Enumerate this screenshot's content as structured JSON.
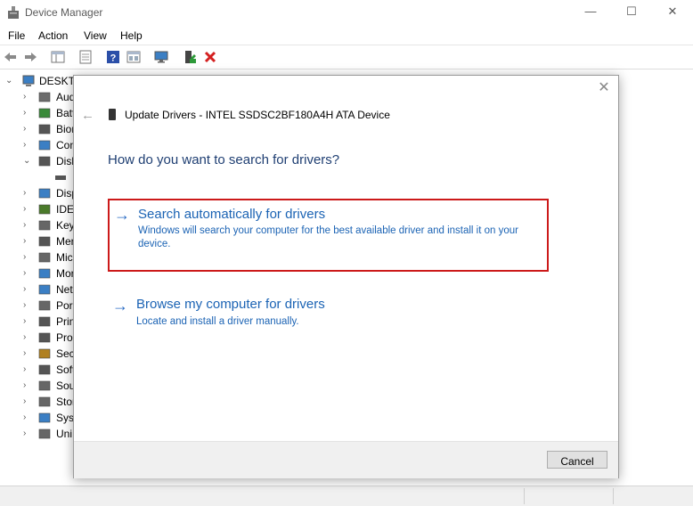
{
  "window": {
    "title": "Device Manager"
  },
  "menu": [
    "File",
    "Action",
    "View",
    "Help"
  ],
  "tree": {
    "root": "DESKTO",
    "items": [
      {
        "label": "Aud",
        "icon": "audio-icon"
      },
      {
        "label": "Batt",
        "icon": "battery-icon"
      },
      {
        "label": "Bior",
        "icon": "biometric-icon"
      },
      {
        "label": "Con",
        "icon": "computer-icon"
      },
      {
        "label": "Disk",
        "icon": "disk-drive-icon",
        "expanded": true
      },
      {
        "label": "",
        "icon": "drive-icon",
        "child": true
      },
      {
        "label": "Disp",
        "icon": "display-icon"
      },
      {
        "label": "IDE",
        "icon": "ide-controller-icon"
      },
      {
        "label": "Key",
        "icon": "keyboard-icon"
      },
      {
        "label": "Mer",
        "icon": "memory-icon"
      },
      {
        "label": "Mic",
        "icon": "mouse-icon"
      },
      {
        "label": "Mor",
        "icon": "monitor-icon"
      },
      {
        "label": "Net",
        "icon": "network-icon"
      },
      {
        "label": "Por",
        "icon": "ports-icon"
      },
      {
        "label": "Prin",
        "icon": "printer-icon"
      },
      {
        "label": "Pro",
        "icon": "processor-icon"
      },
      {
        "label": "Sec",
        "icon": "security-icon"
      },
      {
        "label": "Soft",
        "icon": "software-icon"
      },
      {
        "label": "Sou",
        "icon": "sound-icon"
      },
      {
        "label": "Stor",
        "icon": "storage-icon"
      },
      {
        "label": "Syst",
        "icon": "system-icon"
      },
      {
        "label": "Uni",
        "icon": "usb-icon"
      }
    ]
  },
  "dialog": {
    "title": "Update Drivers - INTEL SSDSC2BF180A4H ATA Device",
    "question": "How do you want to search for drivers?",
    "options": {
      "auto": {
        "title": "Search automatically for drivers",
        "description": "Windows will search your computer for the best available driver and install it on your device."
      },
      "browse": {
        "title": "Browse my computer for drivers",
        "description": "Locate and install a driver manually."
      }
    },
    "cancel": "Cancel"
  },
  "colors": {
    "accent": "#1b63b4",
    "highlight": "#cc1a1a",
    "question": "#1e3e72"
  }
}
